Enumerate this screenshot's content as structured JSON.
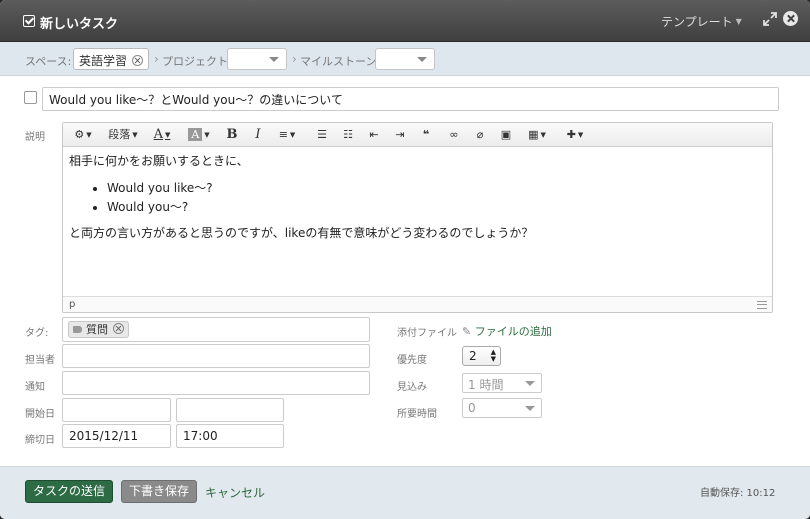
{
  "dialog": {
    "title": "新しいタスク",
    "template_label": "テンプレート"
  },
  "space_bar": {
    "space_label": "スペース:",
    "space_value": "英語学習",
    "project_label": "プロジェクト",
    "project_value": "",
    "milestone_label": "マイルストーン",
    "milestone_value": ""
  },
  "task": {
    "title": "Would you like～？とWould you～？の違いについて",
    "done": false
  },
  "description": {
    "label": "説明",
    "toolbar": {
      "paragraph": "段落",
      "bold": "B",
      "italic": "I",
      "font_color": "A",
      "bg_color": "A",
      "quote": "❝"
    },
    "intro": "相手に何かをお願いするときに、",
    "bullets": [
      "Would you like～?",
      "Would you～?"
    ],
    "closing": "と両方の言い方があると思うのですが、likeの有無で意味がどう変わるのでしょうか？",
    "status_path": "p"
  },
  "fields": {
    "tag_label": "タグ:",
    "tag_value": "質問",
    "assignee_label": "担当者",
    "assignee_value": "",
    "notify_label": "通知",
    "notify_value": "",
    "start_label": "開始日",
    "start_date": "",
    "start_time": "",
    "due_label": "締切日",
    "due_date": "2015/12/11",
    "due_time": "17:00",
    "attachment_label": "添付ファイル",
    "attachment_add": "ファイルの追加",
    "priority_label": "優先度",
    "priority_value": "2",
    "estimate_label": "見込み",
    "estimate_value": "1 時間",
    "actual_label": "所要時間",
    "actual_value": "0"
  },
  "footer": {
    "send_label": "タスクの送信",
    "draft_label": "下書き保存",
    "cancel_label": "キャンセル",
    "autosave": "自動保存: 10:12"
  },
  "colors": {
    "primary_green": "#2d6b45",
    "link_green": "#2e6b3f",
    "header_bg": "#4a4a4a",
    "bar_bg": "#dfe7ee"
  }
}
